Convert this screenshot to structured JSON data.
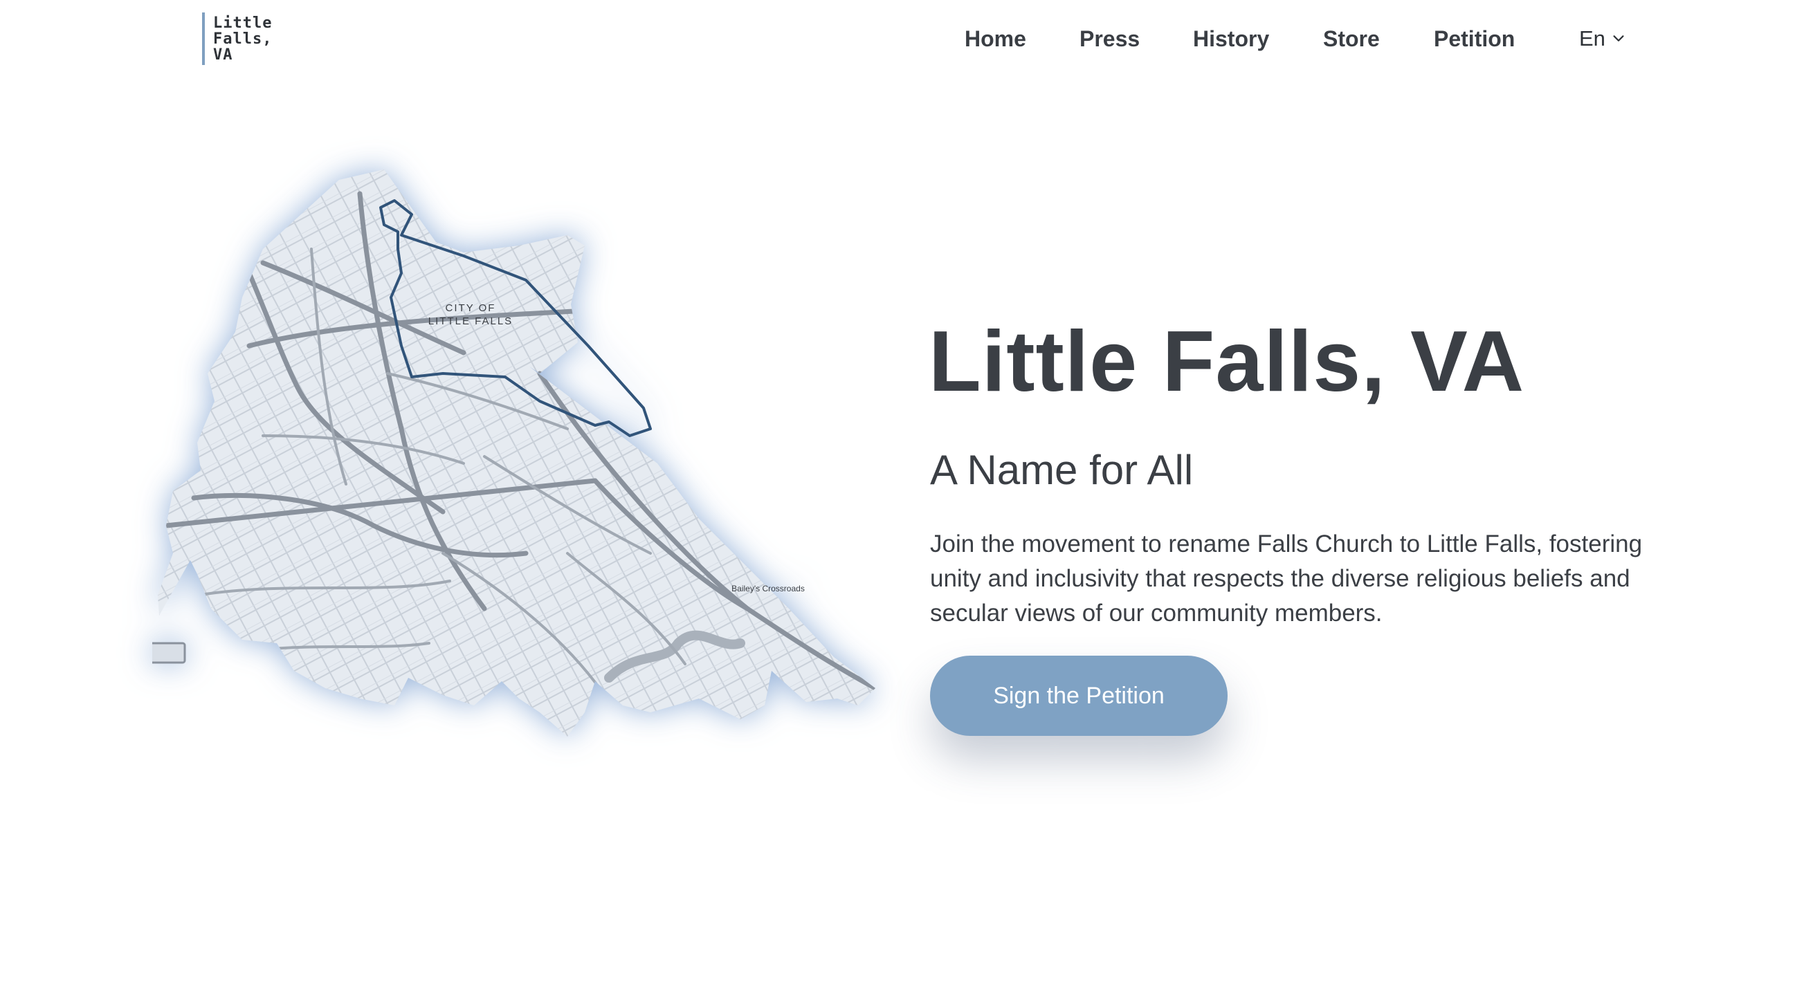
{
  "header": {
    "logo_lines": [
      "Little",
      "Falls,",
      "VA"
    ],
    "nav": [
      "Home",
      "Press",
      "History",
      "Store",
      "Petition"
    ],
    "language": "En"
  },
  "map": {
    "labels": {
      "city_line1": "CITY OF",
      "city_line2": "LITTLE FALLS",
      "baileys": "Bailey's Crossroads"
    },
    "colors": {
      "fill": "#e3e8ef",
      "road": "#8a929d",
      "boundary": "#31547a",
      "glow": "#9cbbe0"
    }
  },
  "hero": {
    "title": "Little Falls, VA",
    "subtitle": "A Name for All",
    "description": "Join the movement to rename Falls Church to Little Falls, fostering unity and inclusivity that respects the diverse religious beliefs and secular views of our community members.",
    "cta_label": "Sign the Petition"
  },
  "colors": {
    "accent": "#7fa2c4",
    "text": "#3b3f45",
    "background": "#ffffff"
  }
}
